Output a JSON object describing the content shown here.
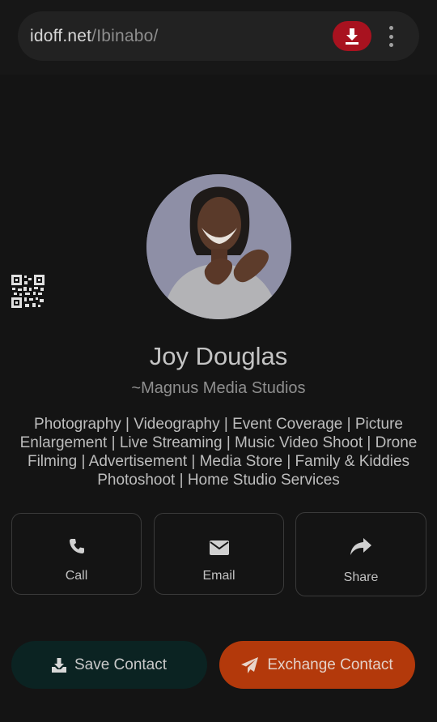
{
  "browser": {
    "url_domain": "idoff.net",
    "url_path": "/Ibinabo/"
  },
  "profile": {
    "name": "Joy Douglas",
    "company": "~Magnus Media Studios",
    "bio": "Photography | Videography | Event Coverage | Picture Enlargement | Live Streaming | Music Video Shoot | Drone Filming | Advertisement | Media Store | Family & Kiddies Photoshoot | Home Studio Services"
  },
  "actions": {
    "call_label": "Call",
    "email_label": "Email",
    "share_label": "Share"
  },
  "buttons": {
    "save_label": "Save Contact",
    "exchange_label": "Exchange Contact"
  },
  "icons": {
    "download": "download-icon",
    "menu": "more-vertical-icon",
    "qr": "qr-code-icon",
    "call": "phone-icon",
    "email": "envelope-icon",
    "share": "share-arrow-icon",
    "save": "download-icon",
    "exchange": "paper-plane-icon"
  },
  "colors": {
    "background": "#141414",
    "download_button": "#a8121f",
    "save_button": "#0b2322",
    "exchange_button": "#b3390b"
  }
}
